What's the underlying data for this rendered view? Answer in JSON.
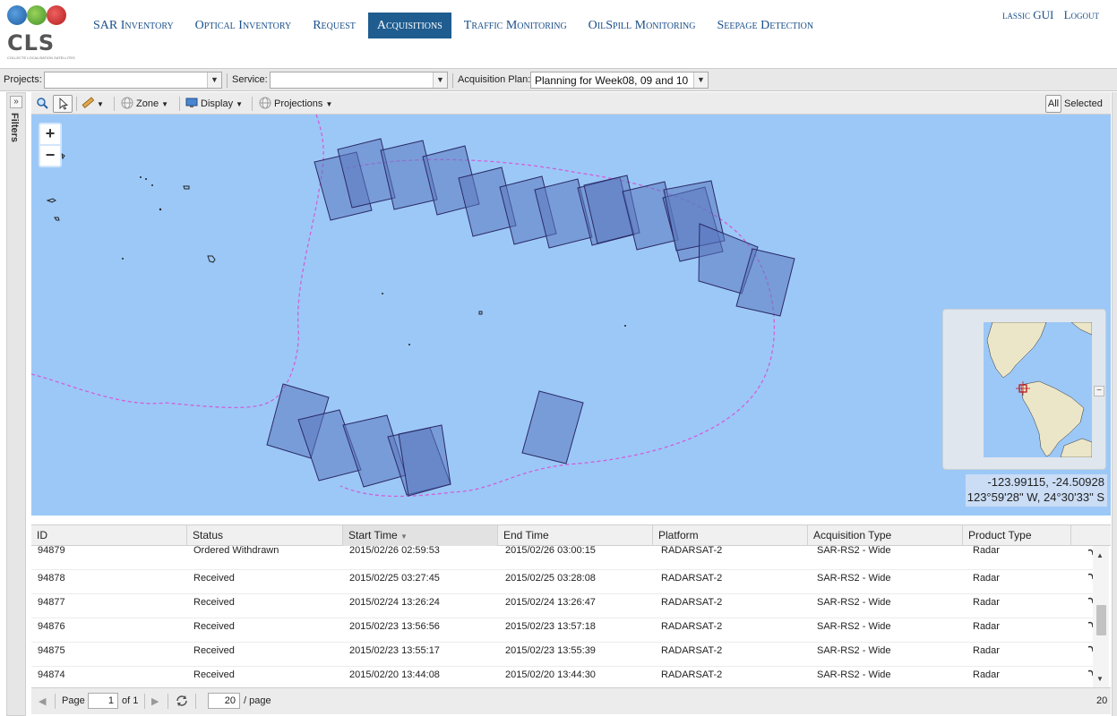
{
  "header": {
    "logo_text": "CLS",
    "logo_subtitle": "COLLECTE LOCALISATION SATELLITES",
    "nav": [
      {
        "label": "SAR Inventory",
        "active": false
      },
      {
        "label": "Optical Inventory",
        "active": false
      },
      {
        "label": "Request",
        "active": false
      },
      {
        "label": "Acquisitions",
        "active": true
      },
      {
        "label": "Traffic Monitoring",
        "active": false
      },
      {
        "label": "OilSpill Monitoring",
        "active": false
      },
      {
        "label": "Seepage Detection",
        "active": false
      }
    ],
    "user_links": [
      "lassic GUI",
      "Logout"
    ]
  },
  "filterbar": {
    "projects_label": "Projects:",
    "projects_value": "",
    "service_label": "Service:",
    "service_value": "",
    "plan_label": "Acquisition Plan:",
    "plan_value": "Planning for Week08, 09 and 10"
  },
  "filters_panel": {
    "label": "Filters"
  },
  "map_toolbar": {
    "zone": "Zone",
    "display": "Display",
    "projections": "Projections",
    "all_label": "All",
    "selected_label": "Selected"
  },
  "map": {
    "zoom_in": "+",
    "zoom_out": "−",
    "coord_decimal": "-123.99115, -24.50928",
    "coord_dms": "123°59'28\" W, 24°30'33\" S",
    "overview_minimize": "−",
    "colors": {
      "ocean": "#9cc8f7",
      "footprint_fill": "#5b78c0",
      "footprint_stroke": "#2a2a66",
      "zone_line": "#d060d8"
    }
  },
  "table": {
    "columns": [
      "ID",
      "Status",
      "Start Time",
      "End Time",
      "Platform",
      "Acquisition Type",
      "Product Type"
    ],
    "sorted_column": "Start Time",
    "rows": [
      [
        "94879",
        "Ordered Withdrawn",
        "2015/02/26 02:59:53",
        "2015/02/26 03:00:15",
        "RADARSAT-2",
        "SAR-RS2 - Wide",
        "Radar"
      ],
      [
        "94878",
        "Received",
        "2015/02/25 03:27:45",
        "2015/02/25 03:28:08",
        "RADARSAT-2",
        "SAR-RS2 - Wide",
        "Radar"
      ],
      [
        "94877",
        "Received",
        "2015/02/24 13:26:24",
        "2015/02/24 13:26:47",
        "RADARSAT-2",
        "SAR-RS2 - Wide",
        "Radar"
      ],
      [
        "94876",
        "Received",
        "2015/02/23 13:56:56",
        "2015/02/23 13:57:18",
        "RADARSAT-2",
        "SAR-RS2 - Wide",
        "Radar"
      ],
      [
        "94875",
        "Received",
        "2015/02/23 13:55:17",
        "2015/02/23 13:55:39",
        "RADARSAT-2",
        "SAR-RS2 - Wide",
        "Radar"
      ],
      [
        "94874",
        "Received",
        "2015/02/20 13:44:08",
        "2015/02/20 13:44:30",
        "RADARSAT-2",
        "SAR-RS2 - Wide",
        "Radar"
      ]
    ]
  },
  "pager": {
    "page_label": "Page",
    "page_value": "1",
    "of_label": "of 1",
    "per_page_value": "20",
    "per_page_label": "/ page",
    "total": "20"
  }
}
